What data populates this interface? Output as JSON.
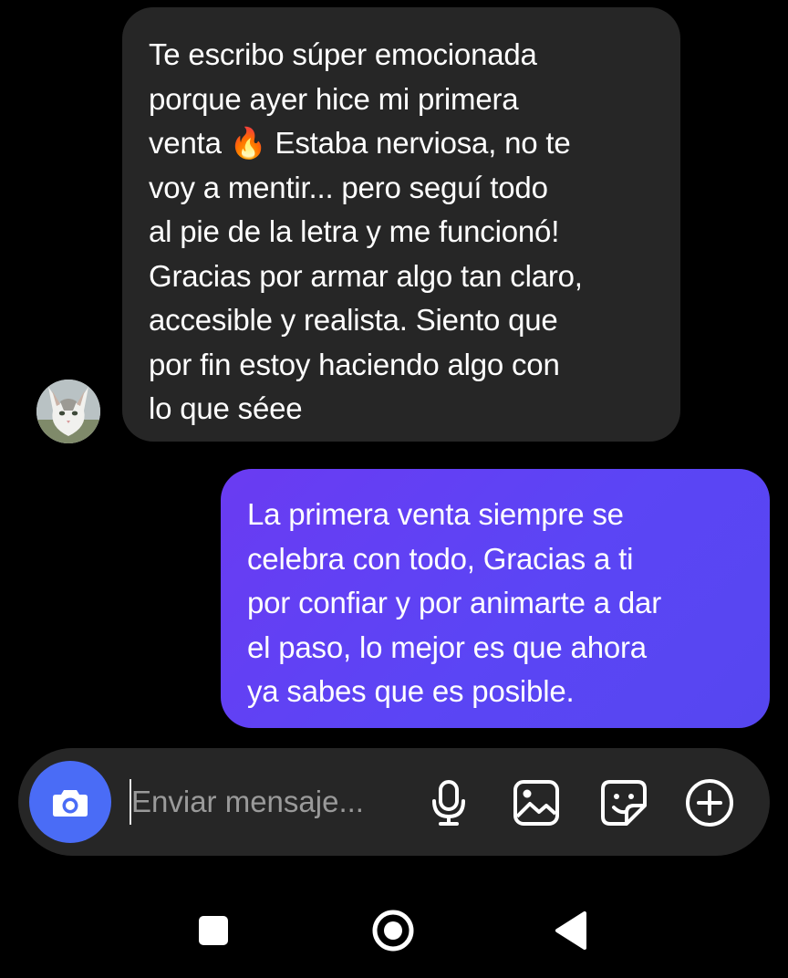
{
  "chat": {
    "received": {
      "avatar_icon": "cat-avatar",
      "text": "Te escribo súper emocionada\nporque ayer hice mi primera\nventa 🔥 Estaba nerviosa, no te\nvoy a mentir... pero seguí todo\nal pie de la letra y  me funcionó!\nGracias por armar algo tan claro,\naccesible y realista. Siento que\npor fin estoy haciendo algo con\nlo que séee"
    },
    "sent": {
      "text": "La primera venta siempre se\ncelebra con todo, Gracias a ti\npor confiar y por animarte a dar\nel paso, lo mejor es que ahora\nya sabes que es posible."
    }
  },
  "composer": {
    "placeholder": "Enviar mensaje...",
    "value": "",
    "icons": [
      "camera-icon",
      "microphone-icon",
      "image-icon",
      "sticker-icon",
      "plus-circle-icon"
    ]
  },
  "navbar": {
    "icons": [
      "recents-square-icon",
      "home-circle-icon",
      "back-triangle-icon"
    ]
  },
  "colors": {
    "background": "#000000",
    "received_bubble": "#262626",
    "sent_bubble": "#5b45f5",
    "camera_button": "#4a6cf6",
    "composer": "#262626",
    "placeholder": "#9a9a9a"
  }
}
